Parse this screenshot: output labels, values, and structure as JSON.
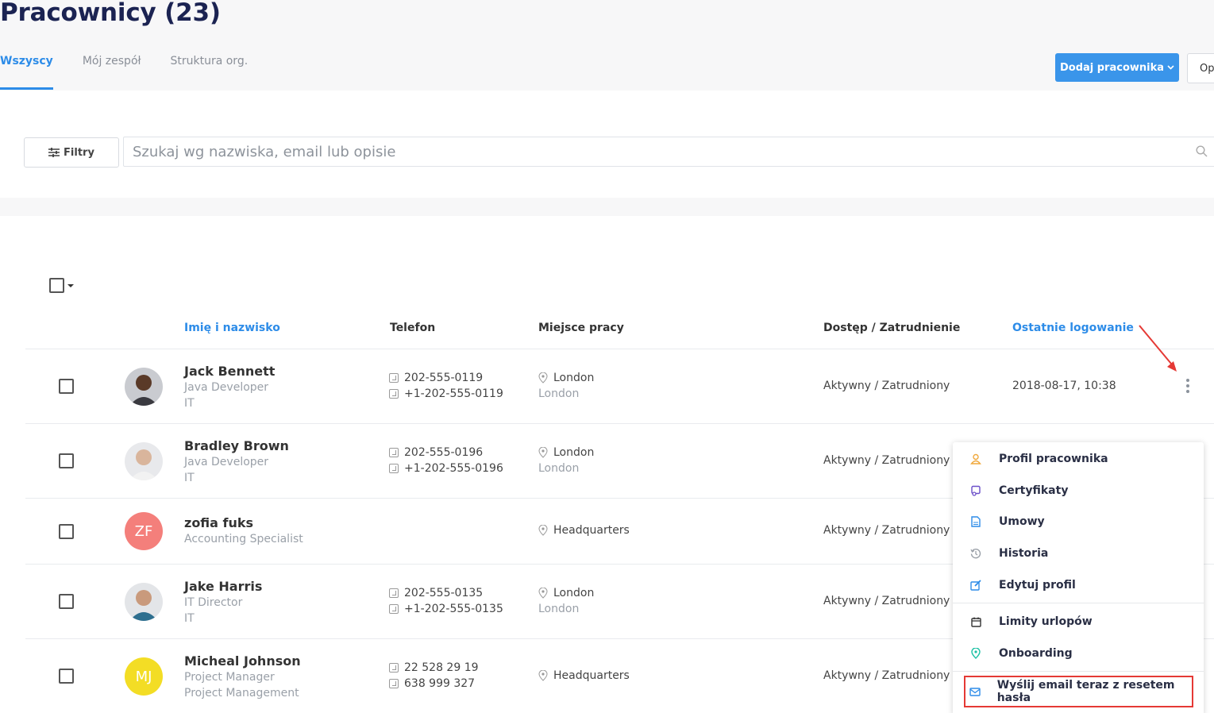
{
  "page": {
    "title": "Pracownicy (23)"
  },
  "tabs": [
    {
      "label": "Wszyscy",
      "active": true
    },
    {
      "label": "Mój zespół",
      "active": false
    },
    {
      "label": "Struktura org.",
      "active": false
    }
  ],
  "actions": {
    "add_label": "Dodaj pracownika",
    "options_label": "Op"
  },
  "filters": {
    "button_label": "Filtry",
    "search_placeholder": "Szukaj wg nazwiska, email lub opisie",
    "search_value": ""
  },
  "table": {
    "headers": {
      "name": "Imię i nazwisko",
      "phone": "Telefon",
      "workplace": "Miejsce pracy",
      "access": "Dostęp / Zatrudnienie",
      "last_login": "Ostatnie logowanie"
    },
    "rows": [
      {
        "name": "Jack Bennett",
        "position": "Java Developer",
        "department": "IT",
        "phones": [
          "202-555-0119",
          "+1-202-555-0119"
        ],
        "location": "London",
        "location_sub": "London",
        "status": "Aktywny / Zatrudniony",
        "last_login": "2018-08-17, 10:38",
        "avatar": "photo"
      },
      {
        "name": "Bradley Brown",
        "position": "Java Developer",
        "department": "IT",
        "phones": [
          "202-555-0196",
          "+1-202-555-0196"
        ],
        "location": "London",
        "location_sub": "London",
        "status": "Aktywny / Zatrudniony",
        "last_login": "",
        "avatar": "photo"
      },
      {
        "name": "zofia fuks",
        "position": "Accounting Specialist",
        "department": "",
        "phones": [],
        "location": "Headquarters",
        "location_sub": "",
        "status": "Aktywny / Zatrudniony",
        "last_login": "",
        "avatar": "ZF",
        "avatar_color": "#f47f7b"
      },
      {
        "name": "Jake Harris",
        "position": "IT Director",
        "department": "IT",
        "phones": [
          "202-555-0135",
          "+1-202-555-0135"
        ],
        "location": "London",
        "location_sub": "London",
        "status": "Aktywny / Zatrudniony",
        "last_login": "",
        "avatar": "photo"
      },
      {
        "name": "Micheal Johnson",
        "position": "Project Manager",
        "department": "Project Management",
        "phones": [
          "22 528 29 19",
          "638 999 327"
        ],
        "location": "Headquarters",
        "location_sub": "",
        "status": "Aktywny / Zatrudniony",
        "last_login": "",
        "avatar": "MJ",
        "avatar_color": "#f3dd25"
      }
    ]
  },
  "context_menu": {
    "items": [
      {
        "label": "Profil pracownika",
        "icon": "user-icon",
        "color": "#f0a83c"
      },
      {
        "label": "Certyfikaty",
        "icon": "certificate-icon",
        "color": "#6b4fc9"
      },
      {
        "label": "Umowy",
        "icon": "document-icon",
        "color": "#2d8ce8"
      },
      {
        "label": "Historia",
        "icon": "history-icon",
        "color": "#9aa0a8"
      },
      {
        "label": "Edytuj profil",
        "icon": "edit-icon",
        "color": "#2d8ce8"
      },
      {
        "label": "Limity urlopów",
        "icon": "calendar-icon",
        "color": "#333333"
      },
      {
        "label": "Onboarding",
        "icon": "location-pin-icon",
        "color": "#1fc1a5"
      },
      {
        "label": "Wyślij email teraz z resetem hasła",
        "icon": "mail-icon",
        "color": "#2d8ce8"
      }
    ]
  },
  "colors": {
    "accent": "#2d8ce8",
    "title": "#1b2352",
    "highlight": "#e53935"
  }
}
